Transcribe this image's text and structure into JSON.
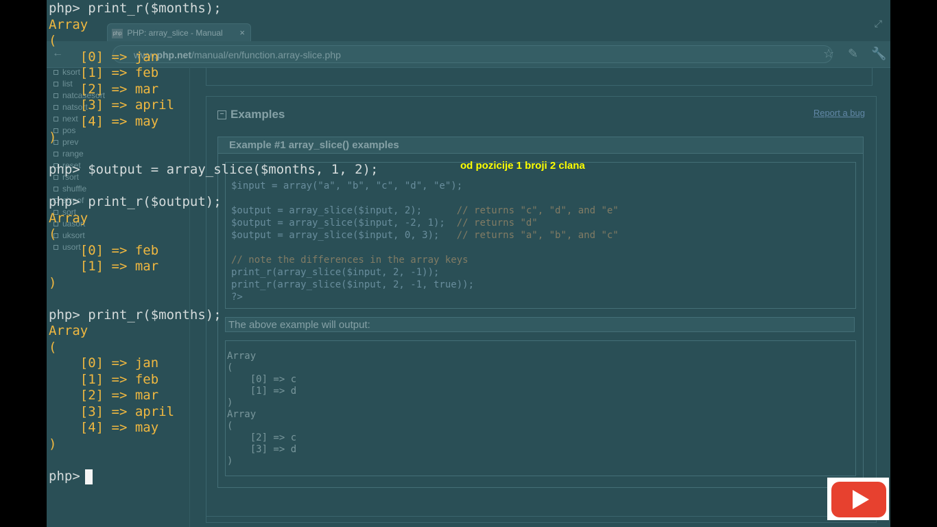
{
  "browser": {
    "tab_title": "PHP: array_slice - Manual",
    "favicon_text": "php",
    "tab_close": "×",
    "url_prefix": "www.",
    "url_domain": "php.net",
    "url_path": "/manual/en/function.array-slice.php",
    "sidebar_items": [
      "ksort",
      "list",
      "natcasesort",
      "natsort",
      "next",
      "pos",
      "prev",
      "range",
      "reset",
      "rsort",
      "shuffle",
      "sizeof",
      "sort",
      "uasort",
      "uksort",
      "usort"
    ],
    "section_title": "Examples",
    "report_link": "Report a bug",
    "example_title": "Example #1 array_slice() examples",
    "code_lines": [
      {
        "text": "$input = array(\"a\", \"b\", \"c\", \"d\", \"e\");",
        "comment": ""
      },
      {
        "text": "",
        "comment": ""
      },
      {
        "text": "$output = array_slice($input, 2);      ",
        "comment": "// returns \"c\", \"d\", and \"e\""
      },
      {
        "text": "$output = array_slice($input, -2, 1);  ",
        "comment": "// returns \"d\""
      },
      {
        "text": "$output = array_slice($input, 0, 3);   ",
        "comment": "// returns \"a\", \"b\", and \"c\""
      },
      {
        "text": "",
        "comment": ""
      },
      {
        "text": "",
        "comment": "// note the differences in the array keys"
      },
      {
        "text": "print_r(array_slice($input, 2, -1));",
        "comment": ""
      },
      {
        "text": "print_r(array_slice($input, 2, -1, true));",
        "comment": ""
      },
      {
        "text": "?>",
        "comment": ""
      }
    ],
    "output_label": "The above example will output:",
    "output_lines": [
      "Array",
      "(",
      "    [0] => c",
      "    [1] => d",
      ")",
      "Array",
      "(",
      "    [2] => c",
      "    [3] => d",
      ")"
    ]
  },
  "terminal": {
    "lines": [
      {
        "text": "php> print_r($months);",
        "kind": "prompt"
      },
      {
        "text": "Array",
        "kind": "out"
      },
      {
        "text": "(",
        "kind": "out"
      },
      {
        "text": "    [0] => jan",
        "kind": "out"
      },
      {
        "text": "    [1] => feb",
        "kind": "out"
      },
      {
        "text": "    [2] => mar",
        "kind": "out"
      },
      {
        "text": "    [3] => april",
        "kind": "out"
      },
      {
        "text": "    [4] => may",
        "kind": "out"
      },
      {
        "text": ")",
        "kind": "out"
      },
      {
        "text": "",
        "kind": "blank"
      },
      {
        "text": "php> $output = array_slice($months, 1, 2);",
        "kind": "prompt"
      },
      {
        "text": "",
        "kind": "blank"
      },
      {
        "text": "php> print_r($output);",
        "kind": "prompt"
      },
      {
        "text": "Array",
        "kind": "out"
      },
      {
        "text": "(",
        "kind": "out"
      },
      {
        "text": "    [0] => feb",
        "kind": "out"
      },
      {
        "text": "    [1] => mar",
        "kind": "out"
      },
      {
        "text": ")",
        "kind": "out"
      },
      {
        "text": "",
        "kind": "blank"
      },
      {
        "text": "php> print_r($months);",
        "kind": "prompt"
      },
      {
        "text": "Array",
        "kind": "out"
      },
      {
        "text": "(",
        "kind": "out"
      },
      {
        "text": "    [0] => jan",
        "kind": "out"
      },
      {
        "text": "    [1] => feb",
        "kind": "out"
      },
      {
        "text": "    [2] => mar",
        "kind": "out"
      },
      {
        "text": "    [3] => april",
        "kind": "out"
      },
      {
        "text": "    [4] => may",
        "kind": "out"
      },
      {
        "text": ")",
        "kind": "out"
      },
      {
        "text": "",
        "kind": "blank"
      },
      {
        "text": "php> ",
        "kind": "prompt"
      }
    ]
  },
  "annotation": "od pozicije 1 broji 2 clana",
  "icons": [
    "back-icon",
    "star-icon",
    "pen-icon",
    "wrench-icon",
    "expand-icon",
    "play-icon"
  ],
  "colors": {
    "prompt": "#d5dcdc",
    "output": "#f0b840",
    "annotation": "#ffff00",
    "play_button": "#e7412f"
  }
}
